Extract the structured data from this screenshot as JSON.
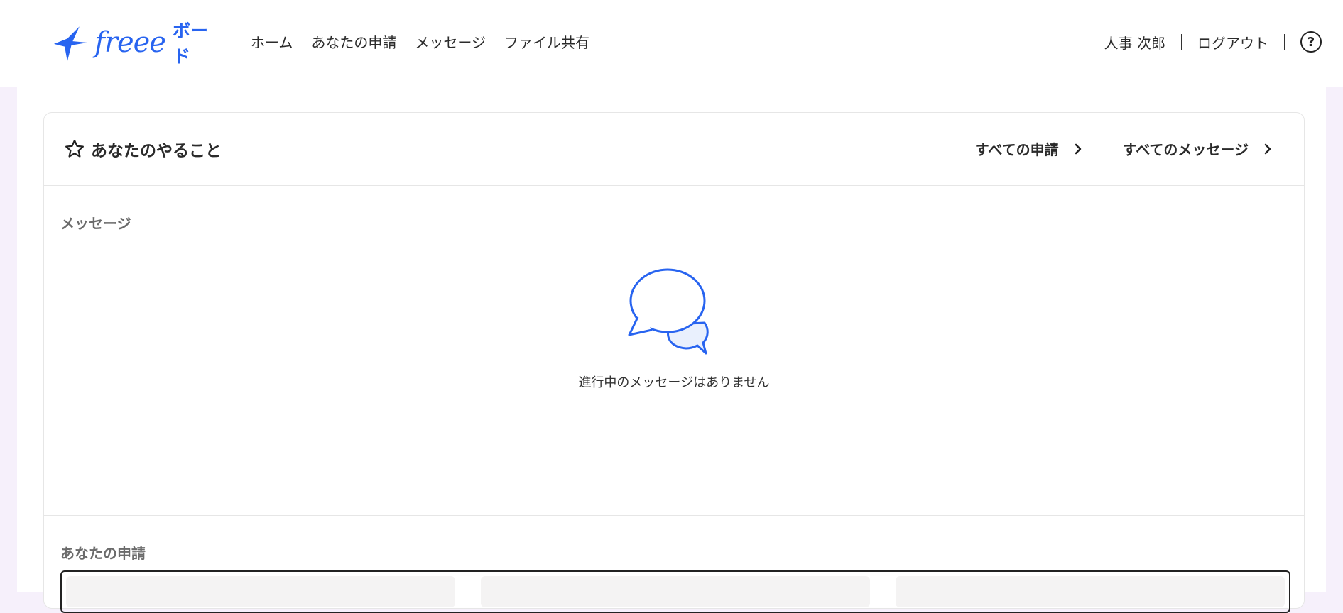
{
  "header": {
    "logo_text": "freee",
    "logo_sub": "ボード",
    "nav": [
      "ホーム",
      "あなたの申請",
      "メッセージ",
      "ファイル共有"
    ],
    "user_name": "人事 次郎",
    "logout": "ログアウト",
    "help_symbol": "?"
  },
  "card": {
    "title": "あなたのやること",
    "links": {
      "all_requests": "すべての申請",
      "all_messages": "すべてのメッセージ"
    }
  },
  "messages": {
    "label": "メッセージ",
    "empty_text": "進行中のメッセージはありません"
  },
  "requests": {
    "label": "あなたの申請"
  },
  "colors": {
    "brand": "#2864f0",
    "page_bg": "#f6f0fb",
    "bubble_fill": "#e9f0fd"
  }
}
